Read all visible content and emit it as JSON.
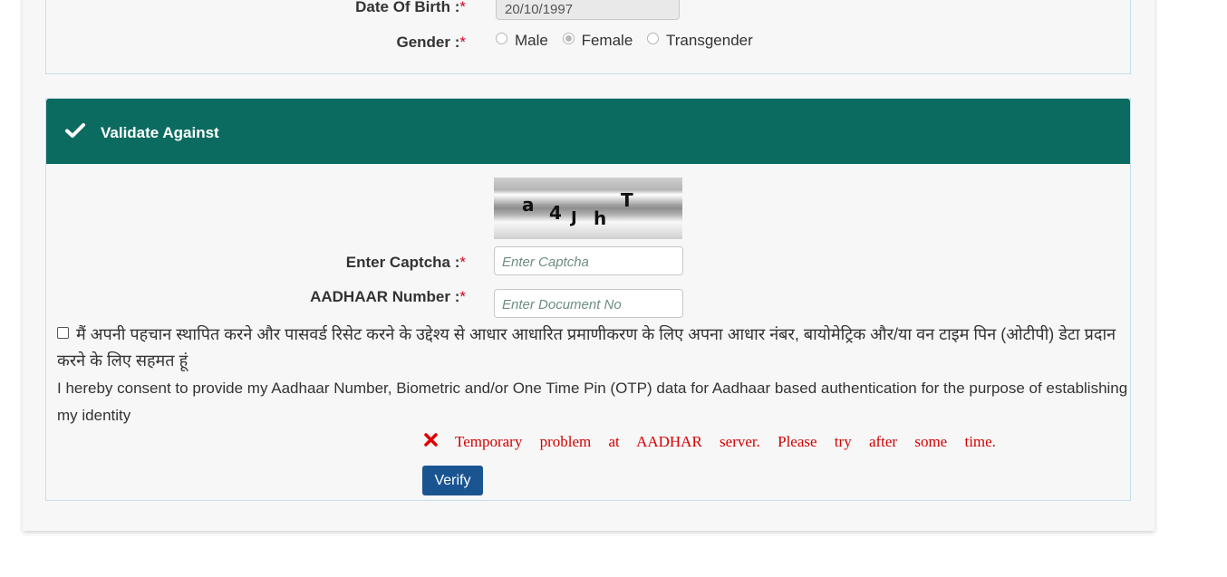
{
  "personal": {
    "dob_label": "Date Of Birth :",
    "dob_value": "20/10/1997",
    "gender_label": "Gender :",
    "required_mark": "*",
    "gender_options": [
      {
        "label": "Male",
        "selected": false
      },
      {
        "label": "Female",
        "selected": true
      },
      {
        "label": "Transgender",
        "selected": false
      }
    ]
  },
  "validate": {
    "header_title": "Validate Against",
    "header_icon": "check-icon",
    "header_color": "#0c6b60",
    "captcha_chars": [
      "a",
      "4",
      "J",
      "h",
      "T"
    ],
    "captcha_label": "Enter Captcha :",
    "captcha_placeholder": "Enter Captcha",
    "aadhaar_label": "AADHAAR Number :",
    "aadhaar_placeholder": "Enter Document No",
    "consent_hindi": "मैं अपनी पहचान स्थापित करने और पासवर्ड रिसेट करने के उद्देश्य से आधार आधारित प्रमाणीकरण के लिए अपना आधार नंबर, बायोमेट्रिक और/या वन टाइम पिन (ओटीपी) डेटा प्रदान करने के लिए सहमत हूं",
    "consent_english": "I hereby consent to provide my Aadhaar Number, Biometric and/or One Time Pin (OTP) data for Aadhaar based authentication for the purpose of establishing my identity",
    "consent_checked": false,
    "error_message": "Temporary problem at AADHAR server. Please try after some time.",
    "error_color": "#d40000",
    "verify_label": "Verify",
    "verify_color": "#1a5592"
  }
}
